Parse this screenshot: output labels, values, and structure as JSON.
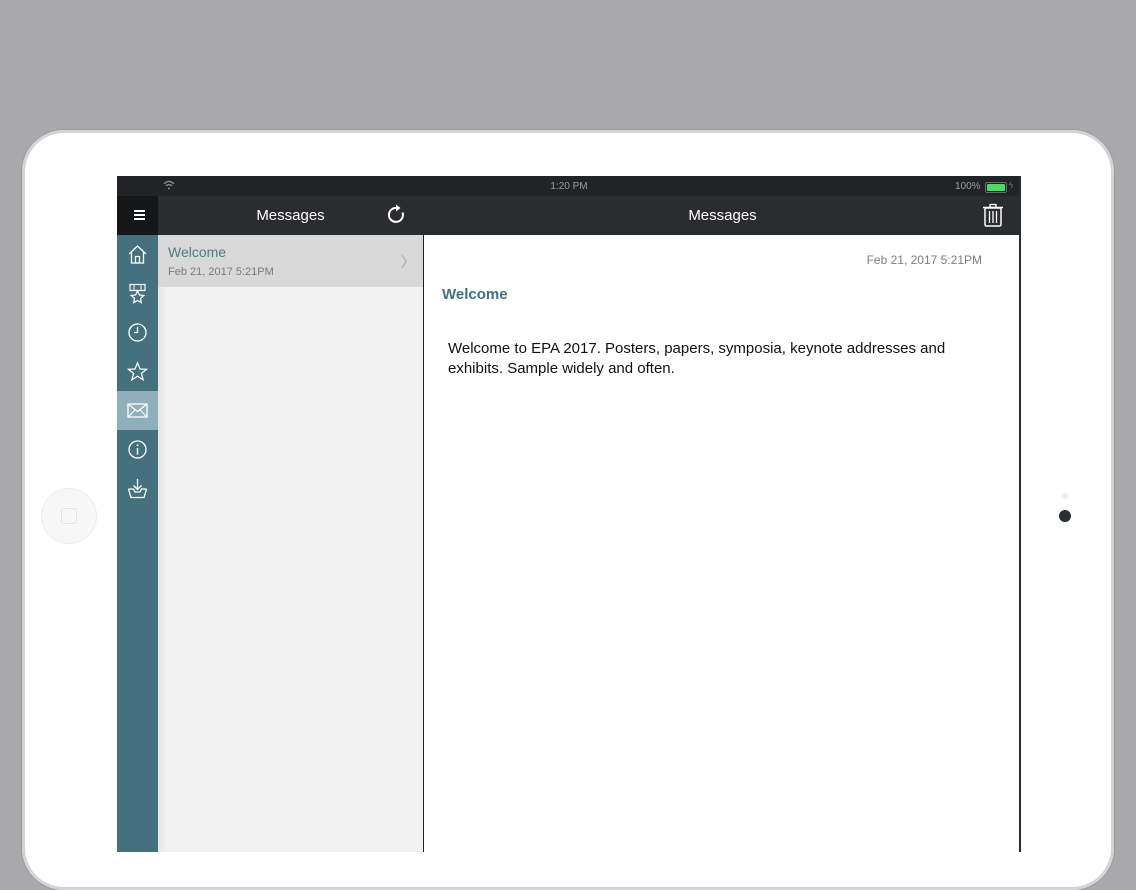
{
  "status_bar": {
    "time": "1:20 PM",
    "battery_percent": "100%"
  },
  "nav": {
    "list_title": "Messages",
    "detail_title": "Messages"
  },
  "sidebar": {
    "items": [
      {
        "icon": "home-icon",
        "active": false
      },
      {
        "icon": "award-icon",
        "active": false
      },
      {
        "icon": "clock-icon",
        "active": false
      },
      {
        "icon": "star-icon",
        "active": false
      },
      {
        "icon": "mail-icon",
        "active": true
      },
      {
        "icon": "info-icon",
        "active": false
      },
      {
        "icon": "download-tray-icon",
        "active": false
      }
    ]
  },
  "messages": [
    {
      "title": "Welcome",
      "date": "Feb 21, 2017 5:21PM"
    }
  ],
  "detail": {
    "date": "Feb 21, 2017 5:21PM",
    "title": "Welcome",
    "body": "Welcome to EPA 2017.  Posters, papers, symposia, keynote addresses and exhibits.  Sample widely and often."
  },
  "colors": {
    "sidebar_bg": "#44717d",
    "sidebar_active": "#8fb0ba",
    "navbar_bg": "#2b2c2f",
    "accent_text": "#44717d",
    "battery": "#4cd964"
  }
}
